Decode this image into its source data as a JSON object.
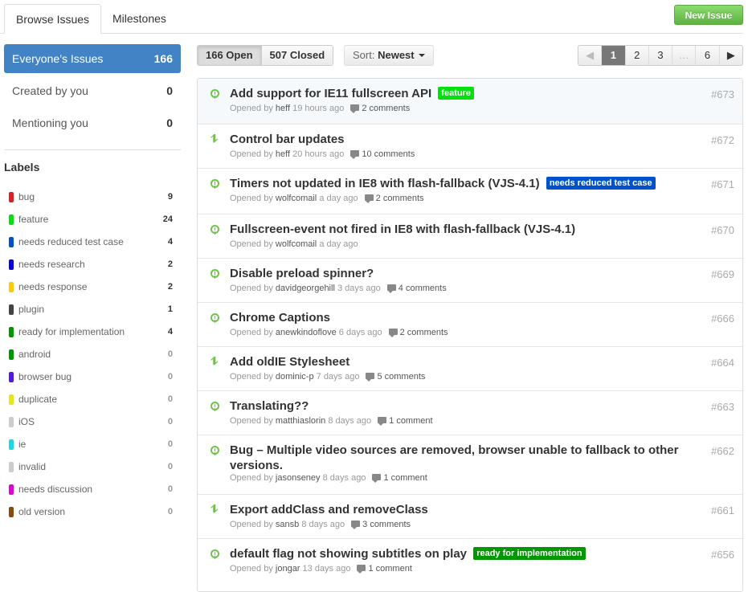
{
  "tabs": [
    {
      "label": "Browse Issues",
      "active": true
    },
    {
      "label": "Milestones",
      "active": false
    }
  ],
  "new_issue_label": "New Issue",
  "filters": [
    {
      "label": "Everyone’s Issues",
      "count": "166",
      "active": true
    },
    {
      "label": "Created by you",
      "count": "0",
      "active": false
    },
    {
      "label": "Mentioning you",
      "count": "0",
      "active": false
    }
  ],
  "labels_title": "Labels",
  "labels": [
    {
      "name": "bug",
      "count": "9",
      "color": "#e11d21"
    },
    {
      "name": "feature",
      "count": "24",
      "color": "#02e10c"
    },
    {
      "name": "needs reduced test case",
      "count": "4",
      "color": "#0052cc"
    },
    {
      "name": "needs research",
      "count": "2",
      "color": "#0b02e1"
    },
    {
      "name": "needs response",
      "count": "2",
      "color": "#fbca04"
    },
    {
      "name": "plugin",
      "count": "1",
      "color": "#444444"
    },
    {
      "name": "ready for implementation",
      "count": "4",
      "color": "#009800"
    },
    {
      "name": "android",
      "count": "0",
      "color": "#009800"
    },
    {
      "name": "browser bug",
      "count": "0",
      "color": "#5319e7"
    },
    {
      "name": "duplicate",
      "count": "0",
      "color": "#e6e61b"
    },
    {
      "name": "iOS",
      "count": "0",
      "color": "#cccccc"
    },
    {
      "name": "ie",
      "count": "0",
      "color": "#1bd8e6"
    },
    {
      "name": "invalid",
      "count": "0",
      "color": "#cccccc"
    },
    {
      "name": "needs discussion",
      "count": "0",
      "color": "#e102d8"
    },
    {
      "name": "old version",
      "count": "0",
      "color": "#8a4b08"
    }
  ],
  "toolbar": {
    "open_label": "166 Open",
    "closed_label": "507 Closed",
    "sort_prefix": "Sort:",
    "sort_value": "Newest"
  },
  "pagination": {
    "prev": "◀",
    "pages": [
      "1",
      "2",
      "3",
      "…",
      "6"
    ],
    "current": "1",
    "next": "▶"
  },
  "issues": [
    {
      "type": "issue",
      "title": "Add support for IE11 fullscreen API",
      "tag": "feature",
      "tag_color": "#02e10c",
      "opened": "Opened by",
      "author": "heff",
      "time": "19 hours ago",
      "comments": "2 comments",
      "number": "#673"
    },
    {
      "type": "pr",
      "title": "Control bar updates",
      "tag": "",
      "tag_color": "",
      "opened": "Opened by",
      "author": "heff",
      "time": "20 hours ago",
      "comments": "10 comments",
      "number": "#672"
    },
    {
      "type": "issue",
      "title": "Timers not updated in IE8 with flash-fallback (VJS-4.1)",
      "tag": "needs reduced test case",
      "tag_color": "#0052cc",
      "opened": "Opened by",
      "author": "wolfcomail",
      "time": "a day ago",
      "comments": "2 comments",
      "number": "#671"
    },
    {
      "type": "issue",
      "title": "Fullscreen-event not fired in IE8 with flash-fallback (VJS-4.1)",
      "tag": "",
      "tag_color": "",
      "opened": "Opened by",
      "author": "wolfcomail",
      "time": "a day ago",
      "comments": "",
      "number": "#670"
    },
    {
      "type": "issue",
      "title": "Disable preload spinner?",
      "tag": "",
      "tag_color": "",
      "opened": "Opened by",
      "author": "davidgeorgehill",
      "time": "3 days ago",
      "comments": "4 comments",
      "number": "#669"
    },
    {
      "type": "issue",
      "title": "Chrome Captions",
      "tag": "",
      "tag_color": "",
      "opened": "Opened by",
      "author": "anewkindoflove",
      "time": "6 days ago",
      "comments": "2 comments",
      "number": "#666"
    },
    {
      "type": "pr",
      "title": "Add oldIE Stylesheet",
      "tag": "",
      "tag_color": "",
      "opened": "Opened by",
      "author": "dominic-p",
      "time": "7 days ago",
      "comments": "5 comments",
      "number": "#664"
    },
    {
      "type": "issue",
      "title": "Translating??",
      "tag": "",
      "tag_color": "",
      "opened": "Opened by",
      "author": "matthiaslorin",
      "time": "8 days ago",
      "comments": "1 comment",
      "number": "#663"
    },
    {
      "type": "issue",
      "title": "Bug – Multiple video sources are removed, browser unable to fallback to other versions.",
      "tag": "",
      "tag_color": "",
      "opened": "Opened by",
      "author": "jasonseney",
      "time": "8 days ago",
      "comments": "1 comment",
      "number": "#662"
    },
    {
      "type": "pr",
      "title": "Export addClass and removeClass",
      "tag": "",
      "tag_color": "",
      "opened": "Opened by",
      "author": "sansb",
      "time": "8 days ago",
      "comments": "3 comments",
      "number": "#661"
    },
    {
      "type": "issue",
      "title": "default flag not showing subtitles on play",
      "tag": "ready for implementation",
      "tag_color": "#009800",
      "opened": "Opened by",
      "author": "jongar",
      "time": "13 days ago",
      "comments": "1 comment",
      "number": "#656"
    }
  ]
}
